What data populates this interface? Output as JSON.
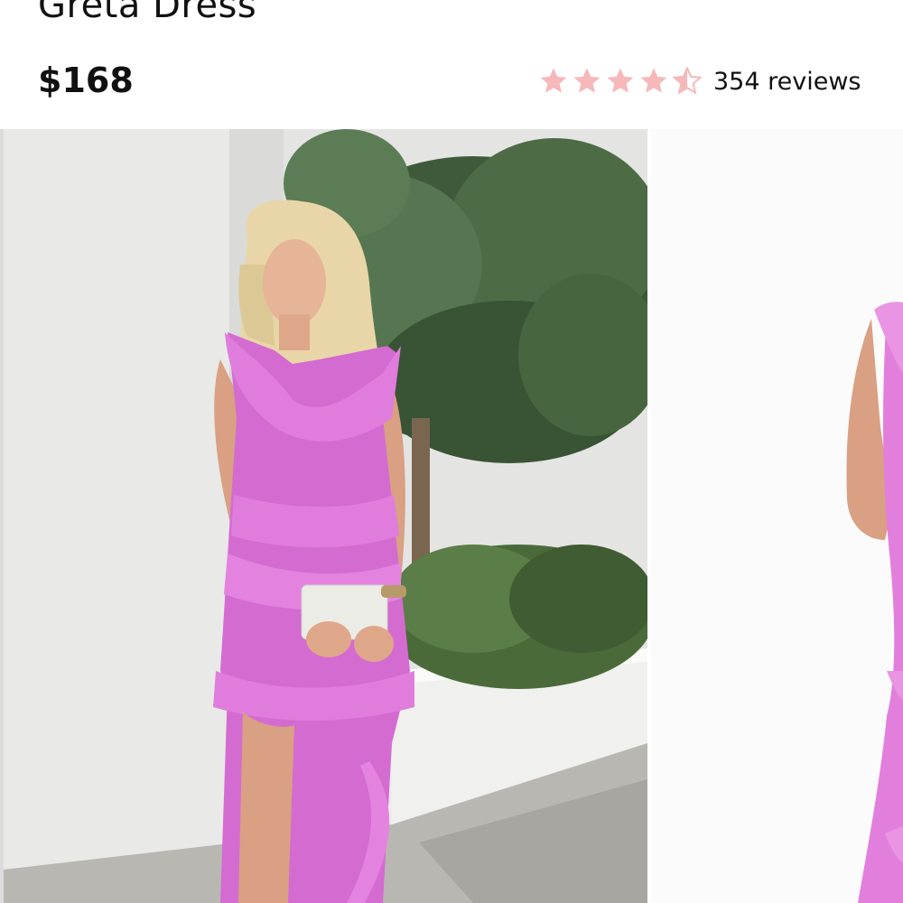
{
  "product": {
    "title": "Greta Dress",
    "price": "$168"
  },
  "rating": {
    "value": 4.5,
    "max": 5,
    "reviews_label": "354 reviews",
    "star_color": "#f6b8b8"
  },
  "gallery": {
    "images": [
      {
        "name": "model-front-outdoor-photo"
      },
      {
        "name": "model-side-studio-photo"
      }
    ]
  }
}
